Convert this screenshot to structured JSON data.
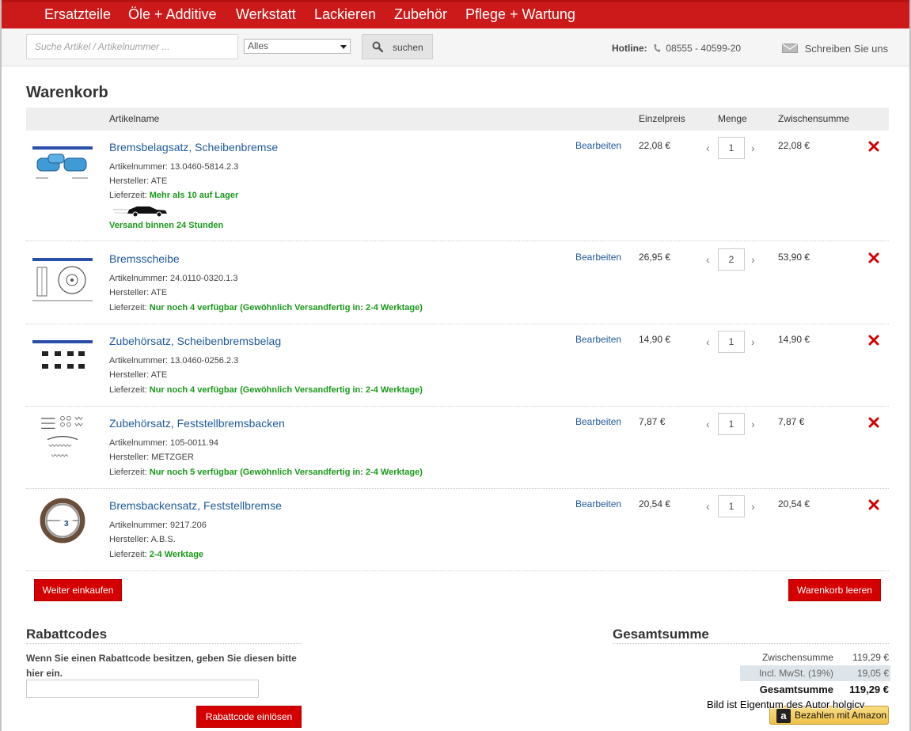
{
  "nav": {
    "items": [
      "Ersatzteile",
      "Öle + Additive",
      "Werkstatt",
      "Lackieren",
      "Zubehör",
      "Pflege + Wartung"
    ]
  },
  "search": {
    "placeholder": "Suche Artikel / Artikelnummer ...",
    "category": "Alles",
    "button_label": "suchen"
  },
  "hotline": {
    "label": "Hotline:",
    "number": "08555 - 40599-20"
  },
  "contact_label": "Schreiben Sie uns",
  "cart": {
    "title": "Warenkorb",
    "columns": {
      "name": "Artikelname",
      "unit_price": "Einzelpreis",
      "quantity": "Menge",
      "subtotal": "Zwischensumme"
    },
    "edit_label": "Bearbeiten",
    "items": [
      {
        "name": "Bremsbelagsatz, Scheibenbremse",
        "sku_label": "Artikelnummer:",
        "sku": "13.0460-5814.2.3",
        "manufacturer_label": "Hersteller:",
        "manufacturer": "ATE",
        "delivery_label": "Lieferzeit:",
        "delivery": "Mehr als 10 auf Lager",
        "shipping_note": "Versand binnen 24 Stunden",
        "unit_price": "22,08 €",
        "quantity": "1",
        "subtotal": "22,08 €"
      },
      {
        "name": "Bremsscheibe",
        "sku_label": "Artikelnummer:",
        "sku": "24.0110-0320.1.3",
        "manufacturer_label": "Hersteller:",
        "manufacturer": "ATE",
        "delivery_label": "Lieferzeit:",
        "delivery": "Nur noch 4 verfügbar (Gewöhnlich Versandfertig in: 2-4 Werktage)",
        "unit_price": "26,95 €",
        "quantity": "2",
        "subtotal": "53,90 €"
      },
      {
        "name": "Zubehörsatz, Scheibenbremsbelag",
        "sku_label": "Artikelnummer:",
        "sku": "13.0460-0256.2.3",
        "manufacturer_label": "Hersteller:",
        "manufacturer": "ATE",
        "delivery_label": "Lieferzeit:",
        "delivery": "Nur noch 4 verfügbar (Gewöhnlich Versandfertig in: 2-4 Werktage)",
        "unit_price": "14,90 €",
        "quantity": "1",
        "subtotal": "14,90 €"
      },
      {
        "name": "Zubehörsatz, Feststellbremsbacken",
        "sku_label": "Artikelnummer:",
        "sku": "105-0011.94",
        "manufacturer_label": "Hersteller:",
        "manufacturer": "METZGER",
        "delivery_label": "Lieferzeit:",
        "delivery": "Nur noch 5 verfügbar (Gewöhnlich Versandfertig in: 2-4 Werktage)",
        "unit_price": "7,87 €",
        "quantity": "1",
        "subtotal": "7,87 €"
      },
      {
        "name": "Bremsbackensatz, Feststellbremse",
        "sku_label": "Artikelnummer:",
        "sku": "9217.206",
        "manufacturer_label": "Hersteller:",
        "manufacturer": "A.B.S.",
        "delivery_label": "Lieferzeit:",
        "delivery": "2-4 Werktage",
        "unit_price": "20,54 €",
        "quantity": "1",
        "subtotal": "20,54 €"
      }
    ],
    "continue_label": "Weiter einkaufen",
    "clear_label": "Warenkorb leeren"
  },
  "coupon": {
    "title": "Rabattcodes",
    "text": "Wenn Sie einen Rabattcode besitzen, geben Sie diesen bitte hier ein.",
    "button_label": "Rabattcode einlösen"
  },
  "totals": {
    "title": "Gesamtsumme",
    "subtotal_label": "Zwischensumme",
    "subtotal": "119,29 €",
    "tax_label": "Incl. MwSt. (19%)",
    "tax": "19,05 €",
    "total_label": "Gesamtsumme",
    "total": "119,29 €"
  },
  "watermark": "Bild ist Eigentum des Autor holgicv",
  "amazon_pay_label": "Bezahlen mit Amazon",
  "colors": {
    "brand_red": "#cc1a1a",
    "link_blue": "#1f5a9c",
    "stock_green": "#1a9a1a"
  }
}
